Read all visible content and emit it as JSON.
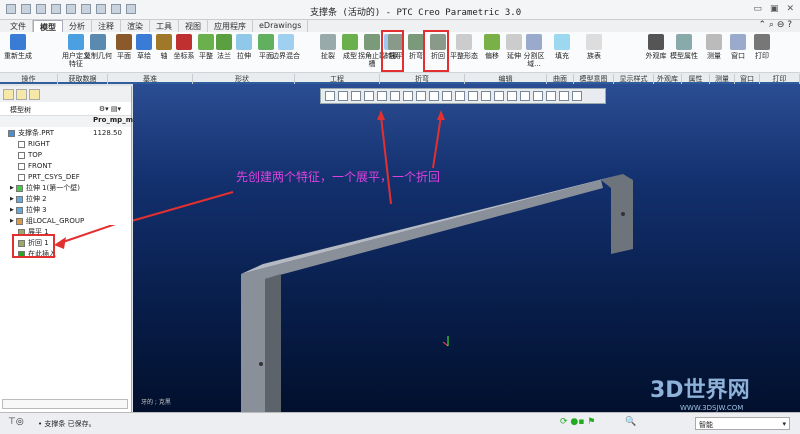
{
  "window": {
    "title": "支撑条 (活动的) - PTC Creo Parametric 3.0"
  },
  "tabs": [
    "文件",
    "模型",
    "分析",
    "注释",
    "渲染",
    "工具",
    "视图",
    "应用程序",
    "eDrawings"
  ],
  "ribbon": {
    "buttons": [
      "重新生成",
      "用户定义特征",
      "复制几何",
      "平面",
      "草绘",
      "轴",
      "坐标系",
      "平整",
      "法兰",
      "拉伸",
      "平面",
      "边界混合",
      "扯裂",
      "成型",
      "拐角止裂槽",
      "转换",
      "展平",
      "折弯",
      "折回",
      "平整形态",
      "偏移",
      "延伸",
      "分割区域...",
      "填充",
      "族表",
      "外观库",
      "模型属性",
      "测量",
      "窗口",
      "打印"
    ],
    "groups": [
      "操作",
      "获取数据",
      "基准",
      "形状",
      "工程",
      "折弯",
      "编辑",
      "曲面",
      "模型意图",
      "显示样式",
      "外观库",
      "属性",
      "测量",
      "窗口",
      "打印"
    ]
  },
  "tree": {
    "title": "模型树",
    "column": "Pro_mp_m",
    "items": [
      {
        "label": "支撑条.PRT",
        "value": "1128.50"
      },
      {
        "label": "RIGHT"
      },
      {
        "label": "TOP"
      },
      {
        "label": "FRONT"
      },
      {
        "label": "PRT_CSYS_DEF"
      },
      {
        "label": "拉伸 1(第一个壁)"
      },
      {
        "label": "拉伸 2"
      },
      {
        "label": "拉伸 3"
      },
      {
        "label": "组LOCAL_GROUP"
      },
      {
        "label": "展平 1"
      },
      {
        "label": "折回 1"
      },
      {
        "label": "在此插入"
      }
    ]
  },
  "viewport": {
    "annotation": "先创建两个特征，一个展平，一个折回",
    "hint": "牙的 ; 克黑"
  },
  "status": {
    "message": "• 支撑条 已保存。",
    "filter": "智能"
  },
  "watermark": {
    "text": "3D世界网",
    "url": "WWW.3DSJW.COM"
  },
  "colors": {
    "highlight": "#e23030",
    "annotation": "#e040e0",
    "part": "#8a9099"
  }
}
